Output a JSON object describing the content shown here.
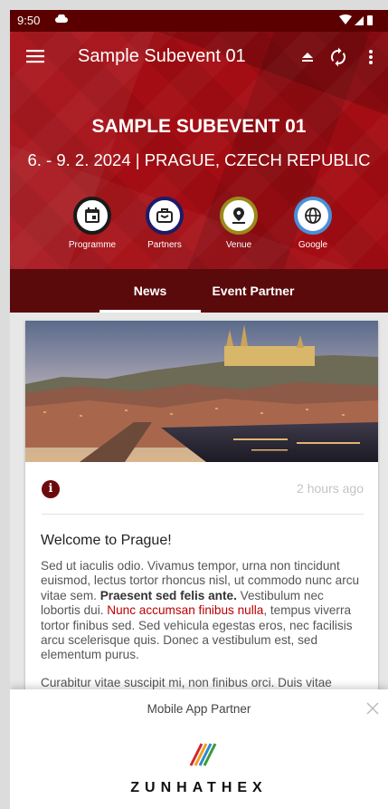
{
  "status": {
    "time": "9:50"
  },
  "toolbar": {
    "title": "Sample Subevent 01"
  },
  "event": {
    "title": "SAMPLE SUBEVENT 01",
    "subtitle": "6. - 9. 2. 2024 | PRAGUE, CZECH REPUBLIC"
  },
  "shortcuts": [
    {
      "label": "Programme",
      "icon": "calendar-icon",
      "ring": "#1a1a1a"
    },
    {
      "label": "Partners",
      "icon": "partners-icon",
      "ring": "#1e1b66"
    },
    {
      "label": "Venue",
      "icon": "location-pin-icon",
      "ring": "#9a8a1a"
    },
    {
      "label": "Google",
      "icon": "globe-icon",
      "ring": "#4a90d9"
    }
  ],
  "tabs": [
    {
      "label": "News",
      "active": true
    },
    {
      "label": "Event Partner",
      "active": false
    }
  ],
  "news": {
    "time_ago": "2 hours ago",
    "headline": "Welcome to Prague!",
    "para1_a": "Sed ut iaculis odio. Vivamus tempor, urna non tincidunt euismod, lectus tortor rhoncus nisl, ut commodo nunc arcu vitae sem. ",
    "para1_bold": "Praesent sed felis ante.",
    "para1_b": " Vestibulum nec lobortis dui. ",
    "para1_link": "Nunc accumsan finibus nulla",
    "para1_c": ", tempus viverra tortor finibus sed. Sed vehicula egestas eros, nec facilisis arcu scelerisque quis. Donec a vestibulum est, sed elementum purus.",
    "para2": "Curabitur vitae suscipit mi, non finibus orci. Duis vitae"
  },
  "partner_sheet": {
    "title": "Mobile App Partner",
    "partner_name": "ZUNHATHEX"
  },
  "colors": {
    "header_red": "#a40d13",
    "dark_red": "#5b0a0c",
    "link": "#bb0000"
  }
}
